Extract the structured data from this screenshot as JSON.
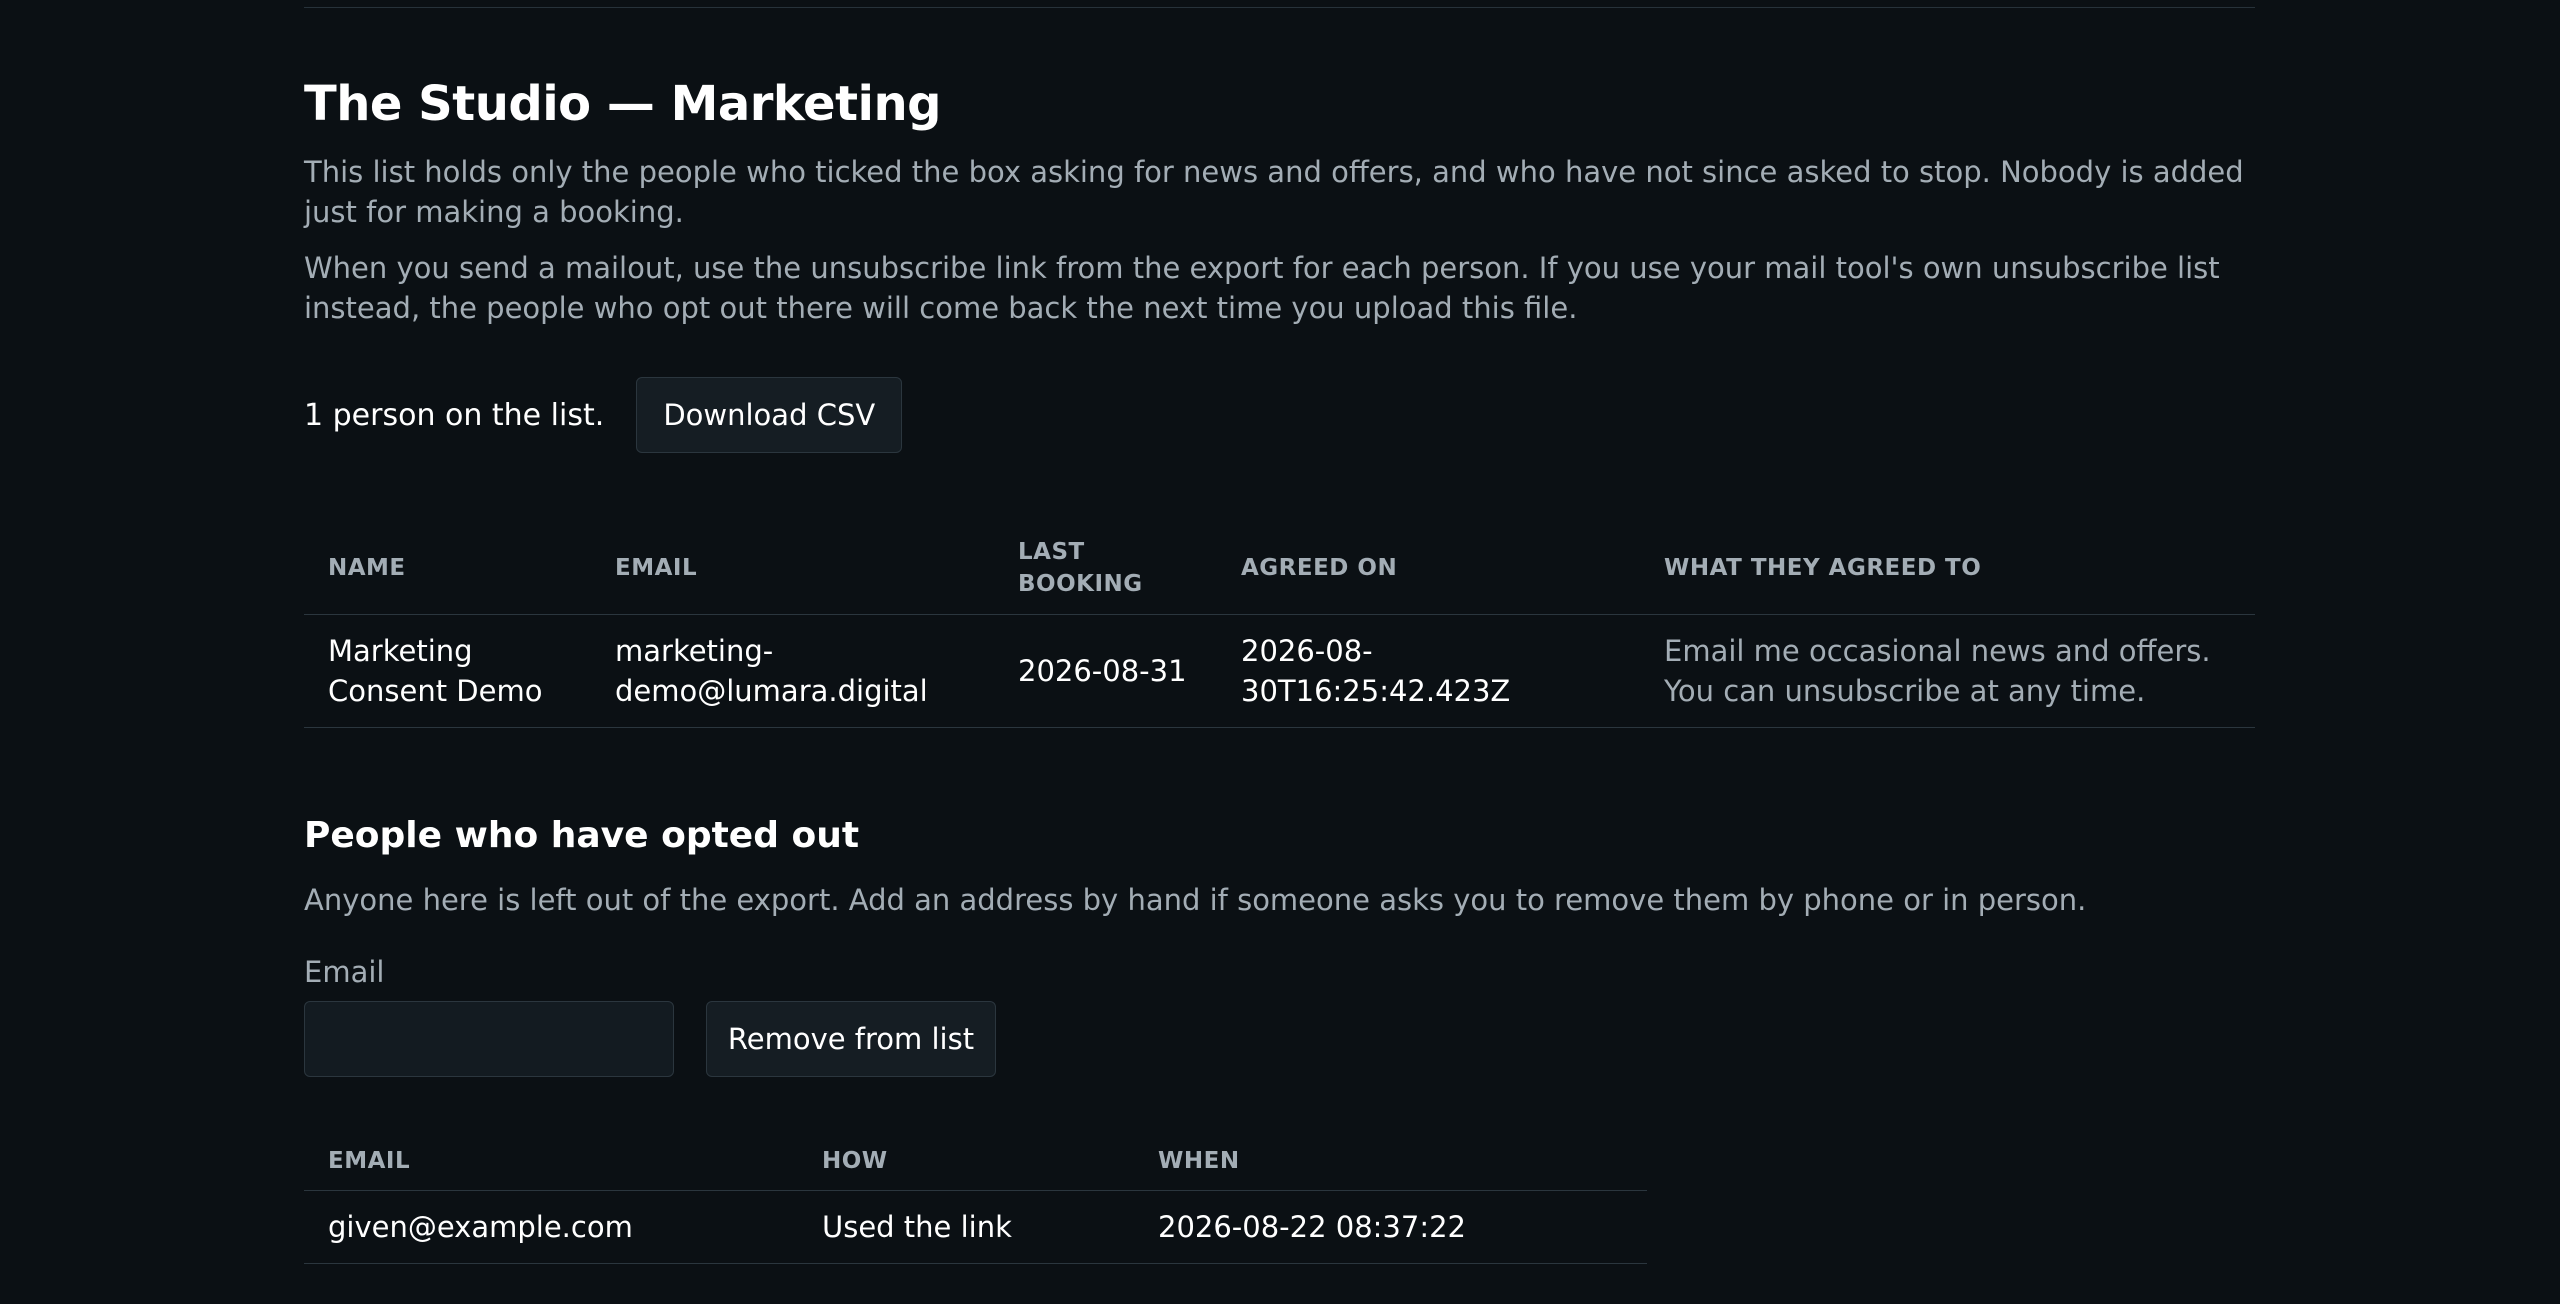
{
  "page": {
    "title": "The Studio — Marketing",
    "intro_1": "This list holds only the people who ticked the box asking for news and offers, and who have not since asked to stop. Nobody is added just for making a booking.",
    "intro_2": "When you send a mailout, use the unsubscribe link from the export for each person. If you use your mail tool's own unsubscribe list instead, the people who opt out there will come back the next time you upload this file."
  },
  "summary": {
    "count_text": "1 person on the list.",
    "download_label": "Download CSV"
  },
  "list_table": {
    "headers": {
      "name": "Name",
      "email": "Email",
      "last_booking": "Last booking",
      "agreed_on": "Agreed on",
      "agreed_to": "What they agreed to"
    },
    "rows": [
      {
        "name": "Marketing Consent Demo",
        "email": "marketing-demo@lumara.digital",
        "last_booking": "2026-08-31",
        "agreed_on": "2026-08-30T16:25:42.423Z",
        "agreed_to": "Email me occasional news and offers. You can unsubscribe at any time."
      }
    ]
  },
  "optout": {
    "title": "People who have opted out",
    "description": "Anyone here is left out of the export. Add an address by hand if someone asks you to remove them by phone or in person.",
    "email_label": "Email",
    "email_value": "",
    "remove_label": "Remove from list",
    "headers": {
      "email": "Email",
      "how": "How",
      "when": "When"
    },
    "rows": [
      {
        "email": "given@example.com",
        "how": "Used the link",
        "when": "2026-08-22 08:37:22"
      }
    ]
  }
}
